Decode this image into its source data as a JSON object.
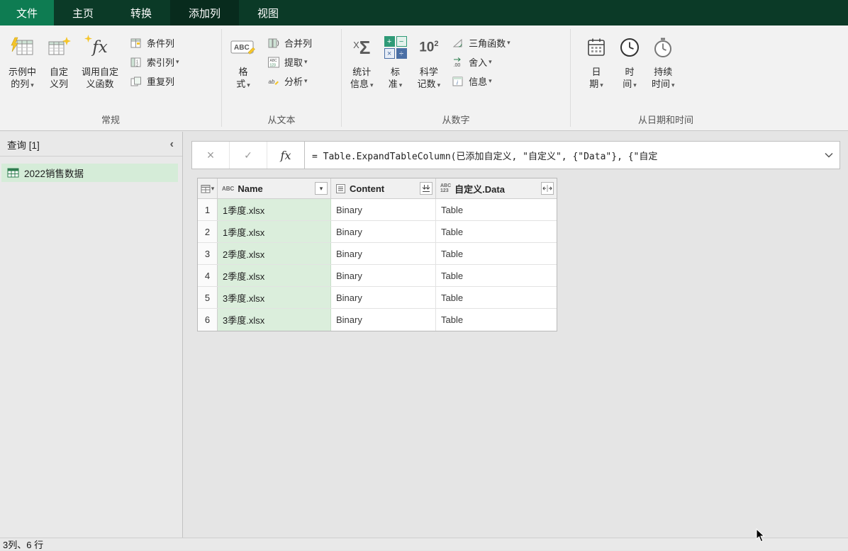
{
  "menubar": {
    "file": "文件",
    "tabs": [
      "主页",
      "转换",
      "添加列",
      "视图"
    ],
    "active_tab": "添加列"
  },
  "ribbon": {
    "groups": [
      {
        "label": "常规",
        "large": [
          {
            "line1": "示例中",
            "line2": "的列"
          },
          {
            "line1": "自定",
            "line2": "义列"
          },
          {
            "line1": "调用自定",
            "line2": "义函数"
          }
        ],
        "small": [
          {
            "label": "条件列"
          },
          {
            "label": "索引列"
          },
          {
            "label": "重复列"
          }
        ]
      },
      {
        "label": "从文本",
        "large": [
          {
            "line1": "格",
            "line2": "式"
          }
        ],
        "small": [
          {
            "label": "合并列"
          },
          {
            "label": "提取"
          },
          {
            "label": "分析"
          }
        ]
      },
      {
        "label": "从数字",
        "large": [
          {
            "line1": "统计",
            "line2": "信息"
          },
          {
            "line1": "标",
            "line2": "准"
          },
          {
            "line1": "科学",
            "line2": "记数"
          }
        ],
        "small": [
          {
            "label": "三角函数"
          },
          {
            "label": "舍入"
          },
          {
            "label": "信息"
          }
        ]
      },
      {
        "label": "从日期和时间",
        "large": [
          {
            "line1": "日",
            "line2": "期"
          },
          {
            "line1": "时",
            "line2": "间"
          },
          {
            "line1": "持续",
            "line2": "时间"
          }
        ],
        "small": []
      }
    ]
  },
  "query_pane": {
    "title": "查询 [1]",
    "items": [
      {
        "name": "2022销售数据",
        "selected": true
      }
    ]
  },
  "formula_bar": {
    "fx": "fx",
    "formula": "= Table.ExpandTableColumn(已添加自定义, \"自定义\", {\"Data\"}, {\"自定"
  },
  "grid": {
    "columns": [
      {
        "name": "Name",
        "type_text": "ABC"
      },
      {
        "name": "Content",
        "type_icon": "binary-list-icon"
      },
      {
        "name": "自定义.Data",
        "type_text": "ABC",
        "type_text2": "123"
      }
    ],
    "rows": [
      {
        "num": "1",
        "name": "1季度.xlsx",
        "content": "Binary",
        "data": "Table"
      },
      {
        "num": "2",
        "name": "1季度.xlsx",
        "content": "Binary",
        "data": "Table"
      },
      {
        "num": "3",
        "name": "2季度.xlsx",
        "content": "Binary",
        "data": "Table"
      },
      {
        "num": "4",
        "name": "2季度.xlsx",
        "content": "Binary",
        "data": "Table"
      },
      {
        "num": "5",
        "name": "3季度.xlsx",
        "content": "Binary",
        "data": "Table"
      },
      {
        "num": "6",
        "name": "3季度.xlsx",
        "content": "Binary",
        "data": "Table"
      }
    ]
  },
  "status_bar": {
    "text": "3列、6 行"
  },
  "icons": {
    "cancel": "×",
    "check": "✓",
    "collapse_pane": "‹",
    "dropdown": "▾"
  },
  "colors": {
    "titlebar": "#0b3a27",
    "file_tab": "#0e7c52",
    "selection_green": "#d5ecd8",
    "column_selected_green": "#dbeedc",
    "accent_green": "#217346"
  }
}
